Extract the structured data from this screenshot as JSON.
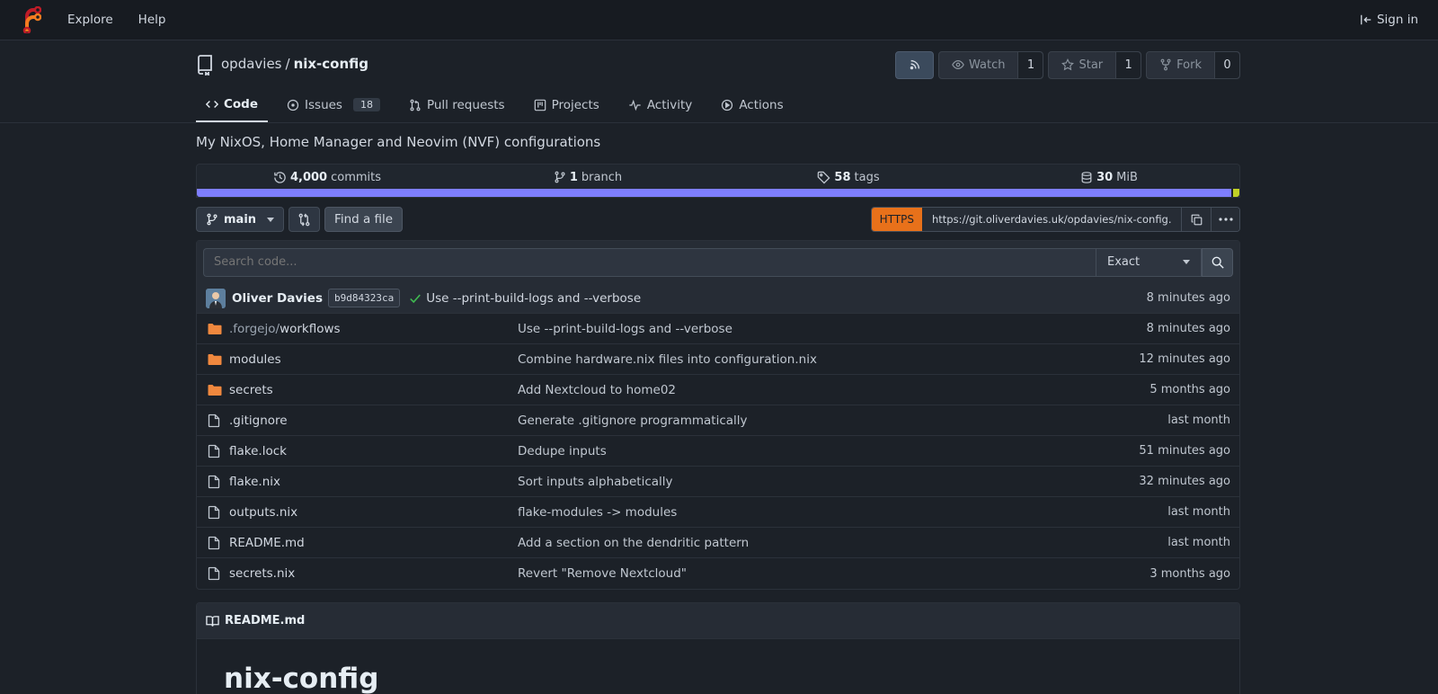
{
  "nav": {
    "logo": "forgejo-logo",
    "explore": "Explore",
    "help": "Help",
    "sign_in": "Sign in"
  },
  "repo": {
    "owner": "opdavies",
    "separator": "/",
    "name": "nix-config",
    "watch_label": "Watch",
    "watch_count": "1",
    "star_label": "Star",
    "star_count": "1",
    "fork_label": "Fork",
    "fork_count": "0"
  },
  "tabs": [
    {
      "label": "Code",
      "icon": "code-icon"
    },
    {
      "label": "Issues",
      "icon": "issue-icon",
      "count": "18"
    },
    {
      "label": "Pull requests",
      "icon": "pull-request-icon"
    },
    {
      "label": "Projects",
      "icon": "project-icon"
    },
    {
      "label": "Activity",
      "icon": "pulse-icon"
    },
    {
      "label": "Actions",
      "icon": "play-icon"
    }
  ],
  "description": "My NixOS, Home Manager and Neovim (NVF) configurations",
  "stats": {
    "commits_count": "4,000",
    "commits_label": "commits",
    "branch_count": "1",
    "branch_label": "branch",
    "tags_count": "58",
    "tags_label": "tags",
    "size_count": "30",
    "size_label": "MiB"
  },
  "languages": [
    {
      "color": "#7e7eff",
      "share": 0.992
    },
    {
      "color": "#1c2128",
      "share": 0.002
    },
    {
      "color": "#c1d026",
      "share": 0.006
    }
  ],
  "toolbar": {
    "branch": "main",
    "find_file": "Find a file",
    "clone_protocol": "HTTPS",
    "clone_url": "https://git.oliverdavies.uk/opdavies/nix-config.git"
  },
  "search": {
    "placeholder": "Search code...",
    "mode": "Exact"
  },
  "latest_commit": {
    "author": "Oliver Davies",
    "sha": "b9d84323ca",
    "message": "Use --print-build-logs and --verbose",
    "time": "8 minutes ago"
  },
  "files": [
    {
      "type": "dir",
      "name_dim": ".forgejo",
      "name_sep": "/",
      "name": "workflows",
      "message": "Use --print-build-logs and --verbose",
      "time": "8 minutes ago"
    },
    {
      "type": "dir",
      "name_dim": "",
      "name_sep": "",
      "name": "modules",
      "message": "Combine hardware.nix files into configuration.nix",
      "time": "12 minutes ago"
    },
    {
      "type": "dir",
      "name_dim": "",
      "name_sep": "",
      "name": "secrets",
      "message": "Add Nextcloud to home02",
      "time": "5 months ago"
    },
    {
      "type": "file",
      "name_dim": "",
      "name_sep": "",
      "name": ".gitignore",
      "message": "Generate .gitignore programmatically",
      "time": "last month"
    },
    {
      "type": "file",
      "name_dim": "",
      "name_sep": "",
      "name": "flake.lock",
      "message": "Dedupe inputs",
      "time": "51 minutes ago"
    },
    {
      "type": "file",
      "name_dim": "",
      "name_sep": "",
      "name": "flake.nix",
      "message": "Sort inputs alphabetically",
      "time": "32 minutes ago"
    },
    {
      "type": "file",
      "name_dim": "",
      "name_sep": "",
      "name": "outputs.nix",
      "message": "flake-modules -> modules",
      "time": "last month"
    },
    {
      "type": "file",
      "name_dim": "",
      "name_sep": "",
      "name": "README.md",
      "message": "Add a section on the dendritic pattern",
      "time": "last month"
    },
    {
      "type": "file",
      "name_dim": "",
      "name_sep": "",
      "name": "secrets.nix",
      "message": "Revert \"Remove Nextcloud\"",
      "time": "3 months ago"
    }
  ],
  "readme": {
    "filename": "README.md",
    "heading": "nix-config"
  },
  "colors": {
    "accent_orange": "#e8711a",
    "folder": "#f0883e",
    "success": "#3fb950"
  }
}
